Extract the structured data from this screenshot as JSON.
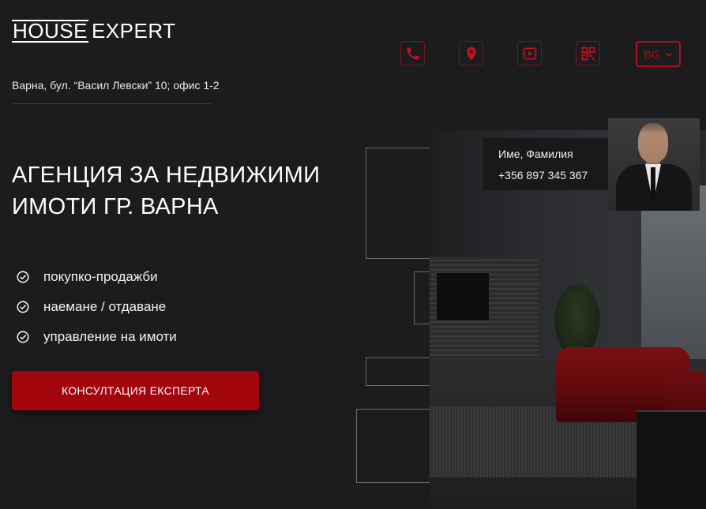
{
  "brand": {
    "logo_part1": "HOUSE",
    "logo_part2": "EXPERT"
  },
  "address": "Варна, бул. “Васил Левски” 10; офис 1-2",
  "header": {
    "icons": [
      {
        "name": "phone-icon"
      },
      {
        "name": "location-pin-icon"
      },
      {
        "name": "video-play-icon"
      },
      {
        "name": "qr-code-icon"
      }
    ],
    "language": {
      "selected": "BG"
    }
  },
  "hero": {
    "title_line1": "АГЕНЦИЯ ЗА НЕДВИЖИМИ",
    "title_line2": "ИМОТИ ГР. ВАРНА",
    "services": [
      "покупко-продажби",
      "наемане / отдаване",
      "управление на имоти"
    ],
    "cta_label": "КОНСУЛТАЦИЯ ЕКСПЕРТА"
  },
  "agent": {
    "name": "Име, Фамилия",
    "phone": "+356 897 345 367"
  },
  "colors": {
    "accent": "#a3050d",
    "background": "#1c1c1e",
    "text": "#ffffff"
  }
}
